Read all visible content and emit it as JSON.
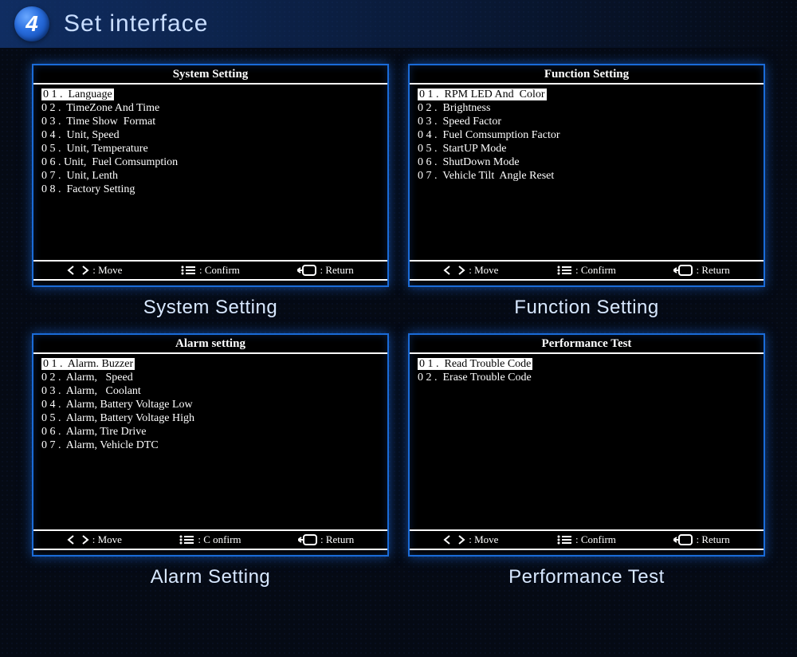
{
  "header": {
    "badge_number": "4",
    "title": "Set interface"
  },
  "panels": [
    {
      "title": "System Setting",
      "caption": "System Setting",
      "selected": 0,
      "items": [
        "0 1 .  Language",
        "0 2 .  TimeZone And Time",
        "0 3 .  Time Show  Format",
        "0 4 .  Unit, Speed",
        "0 5 .  Unit, Temperature",
        "0 6 . Unit,  Fuel Comsumption",
        "0 7 .  Unit, Lenth",
        "0 8 .  Factory Setting"
      ],
      "hints": {
        "move": ": Move",
        "confirm": ": Confirm",
        "return": ": Return"
      }
    },
    {
      "title": "Function Setting",
      "caption": "Function Setting",
      "selected": 0,
      "items": [
        "0 1 .  RPM LED And  Color",
        "0 2 .  Brightness",
        "0 3 .  Speed Factor",
        "0 4 .  Fuel Comsumption Factor",
        "0 5 .  StartUP Mode",
        "0 6 .  ShutDown Mode",
        "0 7 .  Vehicle Tilt  Angle Reset"
      ],
      "hints": {
        "move": ": Move",
        "confirm": ": Confirm",
        "return": ": Return"
      }
    },
    {
      "title": "Alarm setting",
      "caption": "Alarm Setting",
      "selected": 0,
      "items": [
        "0 1 .  Alarm. Buzzer",
        "0 2 .  Alarm,   Speed",
        "0 3 .  Alarm,   Coolant",
        "0 4 .  Alarm, Battery Voltage Low",
        "0 5 .  Alarm, Battery Voltage High",
        "0 6 .  Alarm, Tire Drive",
        "0 7 .  Alarm, Vehicle DTC"
      ],
      "hints": {
        "move": ": Move",
        "confirm": ": C onfirm",
        "return": ": Return"
      }
    },
    {
      "title": "Performance Test",
      "caption": "Performance Test",
      "selected": 0,
      "items": [
        "0 1 .  Read Trouble Code",
        "0 2 .  Erase Trouble Code"
      ],
      "hints": {
        "move": ": Move",
        "confirm": ": Confirm",
        "return": ": Return"
      }
    }
  ]
}
